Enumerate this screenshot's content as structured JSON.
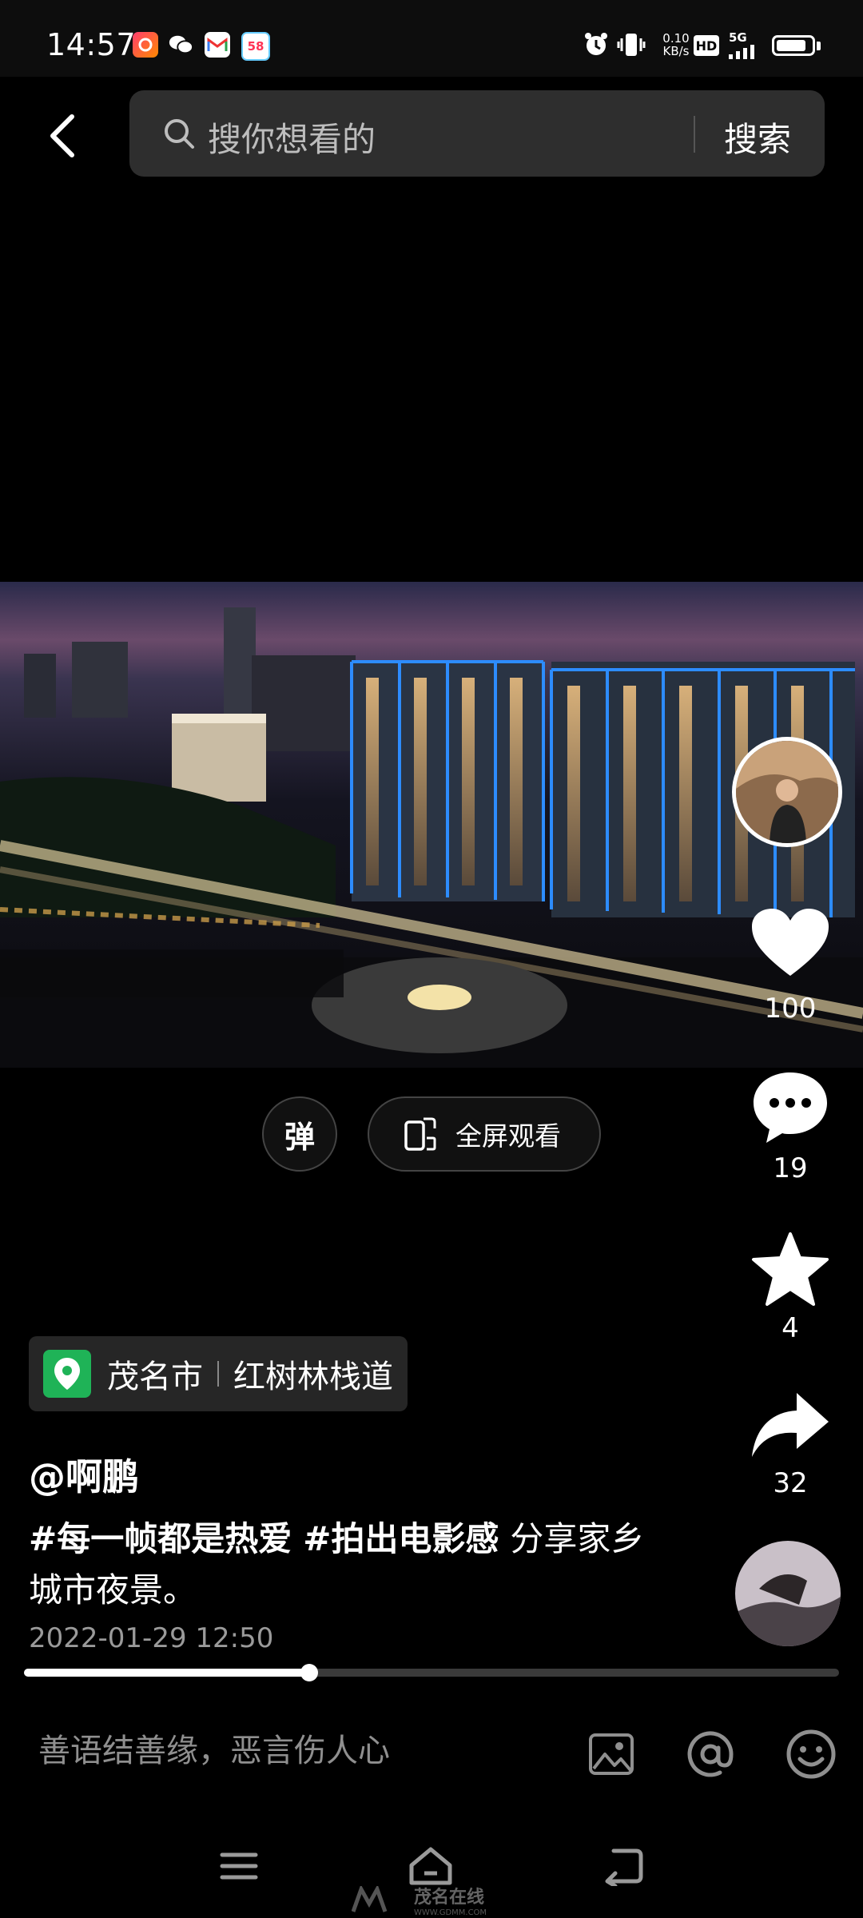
{
  "status_bar": {
    "time": "14:57",
    "app_icons": [
      "app-icon-red",
      "wechat-icon",
      "gmail-icon",
      "58-icon"
    ],
    "net_speed_value": "0.10",
    "net_speed_unit": "KB/s",
    "hd_label": "HD",
    "signal_label": "5G",
    "battery_level": 0.85
  },
  "search": {
    "placeholder": "搜你想看的",
    "button_label": "搜索"
  },
  "rail": {
    "like_count": "100",
    "comment_count": "19",
    "favorite_count": "4",
    "share_count": "32"
  },
  "controls": {
    "danmaku_label": "弹",
    "fullscreen_label": "全屏观看"
  },
  "location": {
    "city": "茂名市",
    "place": "红树林栈道"
  },
  "post": {
    "author": "@啊鹏",
    "hashtags": [
      "#每一帧都是热爱",
      "#拍出电影感"
    ],
    "caption_text": "分享家乡城市夜景。",
    "time": "2022-01-29 12:50"
  },
  "progress": {
    "fraction": 0.35
  },
  "comment_bar": {
    "placeholder": "善语结善缘，恶言伤人心",
    "icons": [
      "image-icon",
      "at-icon",
      "emoji-icon"
    ]
  },
  "nav": {
    "icons": [
      "menu-icon",
      "home-icon",
      "back-nav-icon"
    ]
  },
  "watermark": {
    "text": "茂名在线",
    "subtext": "WWW.GDMM.COM"
  },
  "colors": {
    "location_pin": "#1fb357",
    "background": "#000000",
    "search_box": "#2e2e2e"
  }
}
